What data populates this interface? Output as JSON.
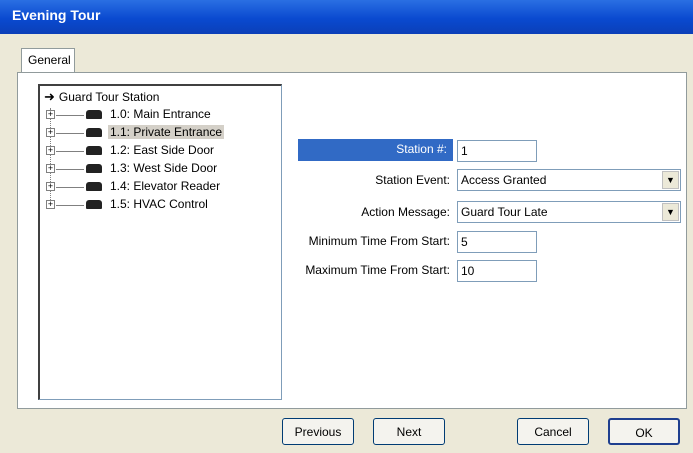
{
  "window": {
    "title": "Evening Tour"
  },
  "tabs": [
    {
      "label": "General"
    }
  ],
  "tree": {
    "root": "Guard Tour Station",
    "items": [
      {
        "label": "1.0: Main Entrance",
        "selected": false
      },
      {
        "label": "1.1: Private Entrance",
        "selected": true
      },
      {
        "label": "1.2: East Side Door",
        "selected": false
      },
      {
        "label": "1.3: West Side Door",
        "selected": false
      },
      {
        "label": "1.4: Elevator Reader",
        "selected": false
      },
      {
        "label": "1.5: HVAC Control",
        "selected": false
      }
    ]
  },
  "form": {
    "station_number": {
      "label": "Station #:",
      "value": "1"
    },
    "station_event": {
      "label": "Station Event:",
      "value": "Access Granted"
    },
    "action_message": {
      "label": "Action Message:",
      "value": "Guard Tour Late"
    },
    "min_time": {
      "label": "Minimum Time From Start:",
      "value": "5"
    },
    "max_time": {
      "label": "Maximum Time From Start:",
      "value": "10"
    }
  },
  "buttons": {
    "previous": "Previous",
    "next": "Next",
    "cancel": "Cancel",
    "ok": "OK"
  },
  "icons": {
    "expander": "plus-box-icon",
    "root": "arrow-right-icon",
    "device": "card-reader-icon",
    "dropdown": "chevron-down-icon"
  }
}
